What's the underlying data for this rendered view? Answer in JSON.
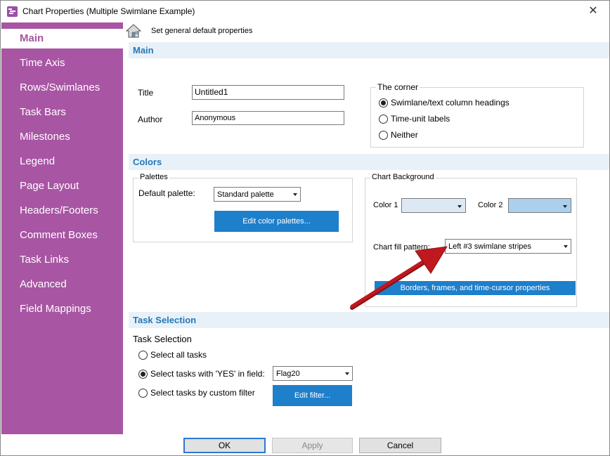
{
  "window": {
    "title": "Chart Properties (Multiple Swimlane Example)"
  },
  "sidebar": {
    "items": [
      {
        "label": "Main",
        "active": true
      },
      {
        "label": "Time Axis"
      },
      {
        "label": "Rows/Swimlanes"
      },
      {
        "label": "Task Bars"
      },
      {
        "label": "Milestones"
      },
      {
        "label": "Legend"
      },
      {
        "label": "Page Layout"
      },
      {
        "label": "Headers/Footers"
      },
      {
        "label": "Comment Boxes"
      },
      {
        "label": "Task Links"
      },
      {
        "label": "Advanced"
      },
      {
        "label": "Field Mappings"
      }
    ]
  },
  "header": {
    "text": "Set general default properties"
  },
  "main_section": {
    "heading": "Main",
    "title_label": "Title",
    "title_value": "Untitled1",
    "author_label": "Author",
    "author_value": "Anonymous",
    "corner": {
      "title": "The corner",
      "options": [
        {
          "label": "Swimlane/text column headings",
          "checked": true
        },
        {
          "label": "Time-unit labels",
          "checked": false
        },
        {
          "label": "Neither",
          "checked": false
        }
      ]
    }
  },
  "colors_section": {
    "heading": "Colors",
    "palettes": {
      "title": "Palettes",
      "default_label": "Default palette:",
      "default_value": "Standard palette",
      "edit_button": "Edit color palettes..."
    },
    "background": {
      "title": "Chart Background",
      "color1_label": "Color 1",
      "color1_value": "#dce9f5",
      "color2_label": "Color 2",
      "color2_value": "#aad0ee",
      "fill_label": "Chart fill pattern:",
      "fill_value": "Left #3 swimlane stripes",
      "borders_button": "Borders, frames, and time-cursor properties"
    }
  },
  "task_section": {
    "heading": "Task Selection",
    "subtitle": "Task Selection",
    "options": [
      {
        "label": "Select all tasks",
        "checked": false
      },
      {
        "label": "Select tasks with 'YES' in field:",
        "checked": true
      },
      {
        "label": "Select tasks by custom filter",
        "checked": false
      }
    ],
    "field_value": "Flag20",
    "edit_filter_button": "Edit filter..."
  },
  "footer": {
    "ok": "OK",
    "apply": "Apply",
    "cancel": "Cancel"
  },
  "colors": {
    "sidebar": "#a855a3",
    "accent": "#1e7fcb",
    "section_band": "#e8f1f8",
    "section_text": "#2478b8",
    "arrow": "#c0181f"
  }
}
